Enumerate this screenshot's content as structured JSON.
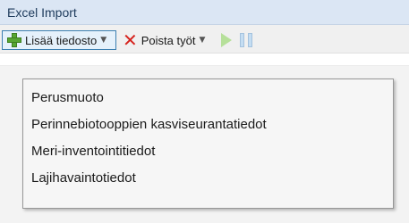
{
  "window": {
    "title": "Excel Import"
  },
  "toolbar": {
    "add_label": "Lisää tiedosto",
    "remove_label": "Poista työt",
    "icons": {
      "add": "plus-icon",
      "remove": "x-icon",
      "dropdown": "chevron-down-icon",
      "play": "play-icon",
      "pause": "pause-icon"
    }
  },
  "menu": {
    "items": [
      {
        "label": "Perusmuoto"
      },
      {
        "label": "Perinnebiotooppien kasviseurantatiedot"
      },
      {
        "label": "Meri-inventointitiedot"
      },
      {
        "label": "Lajihavaintotiedot"
      }
    ]
  },
  "colors": {
    "titlebar": "#dbe6f4",
    "add_icon": "#58a632",
    "remove_icon": "#d6231d",
    "play_icon": "#b6e09a",
    "pause_icon": "#c4ddf2",
    "selected_border": "#3c7fb1"
  }
}
